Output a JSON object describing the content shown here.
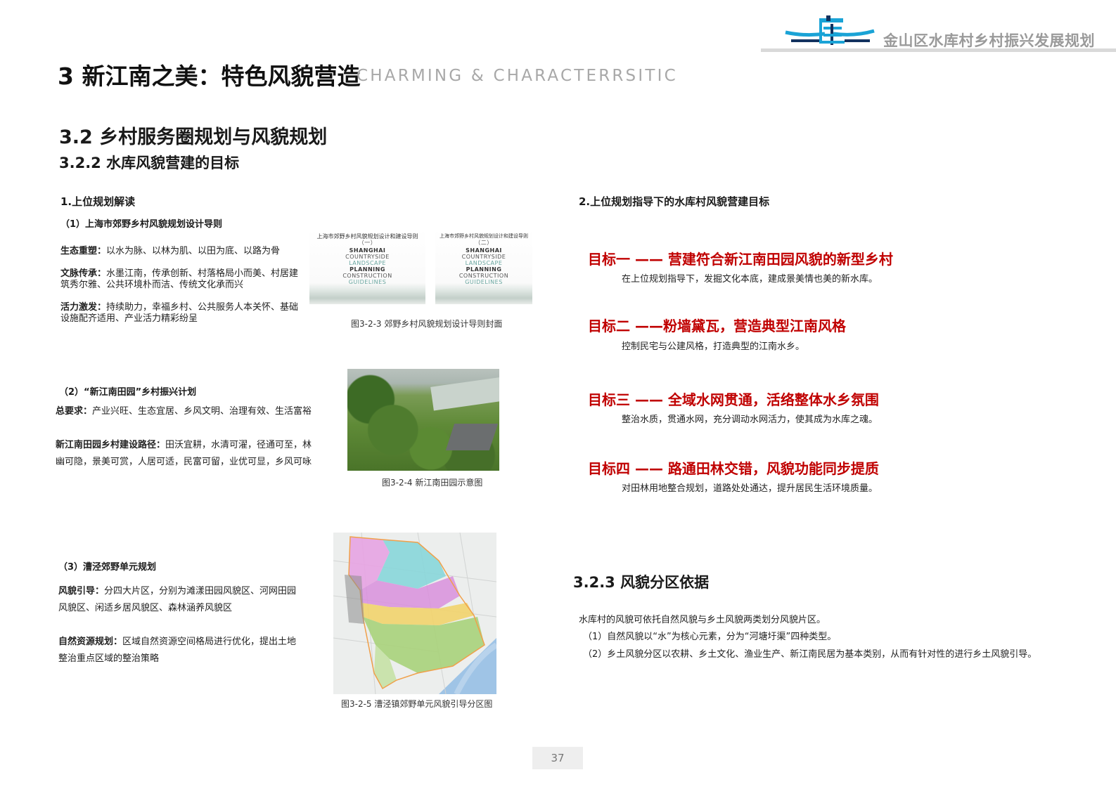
{
  "header": {
    "doc_title": "金山区水库村乡村振兴发展规划",
    "logo_text": "库"
  },
  "section": {
    "title": "3 新江南之美：特色风貌营造",
    "subtitle_en": "CHARMING & CHARACTERRSITIC",
    "h2": "3.2 乡村服务圈规划与风貌规划",
    "h3": "3.2.2 水库风貌营建的目标"
  },
  "left": {
    "heading": "1.上位规划解读",
    "part1": {
      "title": "（1）上海市郊野乡村风貌规划设计导则",
      "items": [
        {
          "label": "生态重塑：",
          "text": "以水为脉、以林为肌、以田为底、以路为骨"
        },
        {
          "label": "文脉传承：",
          "text": "水墨江南，传承创新、村落格局小而美、村居建筑秀尔雅、公共环境朴而洁、传统文化承而兴"
        },
        {
          "label": "活力激发：",
          "text": "持续助力，幸福乡村、公共服务人本关怀、基础设施配齐适用、产业活力精彩纷呈"
        }
      ],
      "cover1": {
        "title": "上海市郊野乡村风貌规划设计和建设导则",
        "vol": "（一）",
        "words": [
          "SHANGHAI",
          "COUNTRYSIDE",
          "LANDSCAPE",
          "PLANNING",
          "CONSTRUCTION",
          "GUIDELINES"
        ]
      },
      "cover2": {
        "title": "上海市郊野乡村风貌规划设计和建设导则",
        "vol": "（二）",
        "words": [
          "SHANGHAI",
          "COUNTRYSIDE",
          "LANDSCAPE",
          "PLANNING",
          "CONSTRUCTION",
          "GUIDELINES"
        ]
      },
      "caption": "图3-2-3 郊野乡村风貌规划设计导则封面"
    },
    "part2": {
      "title": "（2）“新江南田园”乡村振兴计划",
      "req_label": "总要求：",
      "req_text": "产业兴旺、生态宜居、乡风文明、治理有效、生活富裕",
      "path_label": "新江南田园乡村建设路径：",
      "path_text": "田沃宜耕，水清可濯，径通可至，林幽可隐，景美可赏，人居可适，民富可留，业优可显，乡风可咏",
      "caption": "图3-2-4 新江南田园示意图"
    },
    "part3": {
      "title": "（3）漕泾郊野单元规划",
      "guide_label": "风貌引导：",
      "guide_text": "分四大片区，分别为滩漾田园风貌区、河网田园风貌区、闲适乡居风貌区、森林涵养风貌区",
      "res_label": "自然资源规划：",
      "res_text": "区域自然资源空间格局进行优化，提出土地整治重点区域的整治策略",
      "caption": "图3-2-5 漕泾镇郊野单元风貌引导分区图"
    }
  },
  "right": {
    "heading": "2.上位规划指导下的水库村风貌营建目标",
    "goals": [
      {
        "title": "目标一 —— 营建符合新江南田园风貌的新型乡村",
        "desc": "在上位规划指导下，发掘文化本底，建成景美情也美的新水库。"
      },
      {
        "title": "目标二 ——粉墙黛瓦，营造典型江南风格",
        "desc": "控制民宅与公建风格，打造典型的江南水乡。"
      },
      {
        "title": "目标三 —— 全域水网贯通，活络整体水乡氛围",
        "desc": "整治水质，贯通水网，充分调动水网活力，使其成为水库之魂。"
      },
      {
        "title": "目标四 —— 路通田林交错，风貌功能同步提质",
        "desc": "对田林用地整合规划，道路处处通达，提升居民生活环境质量。"
      }
    ],
    "h3b": "3.2.3 风貌分区依据",
    "basis_lines": [
      "水库村的风貌可依托自然风貌与乡土风貌两类划分风貌片区。",
      "（1）自然风貌以“水”为核心元素，分为“河塘圩渠”四种类型。",
      "（2）乡土风貌分区以农耕、乡土文化、渔业生产、新江南民居为基本类别，从而有针对性的进行乡土风貌引导。"
    ]
  },
  "page_number": "37",
  "colors": {
    "accent_red": "#c00000",
    "logo_blue": "#1aa3d6",
    "logo_navy": "#13325f"
  }
}
